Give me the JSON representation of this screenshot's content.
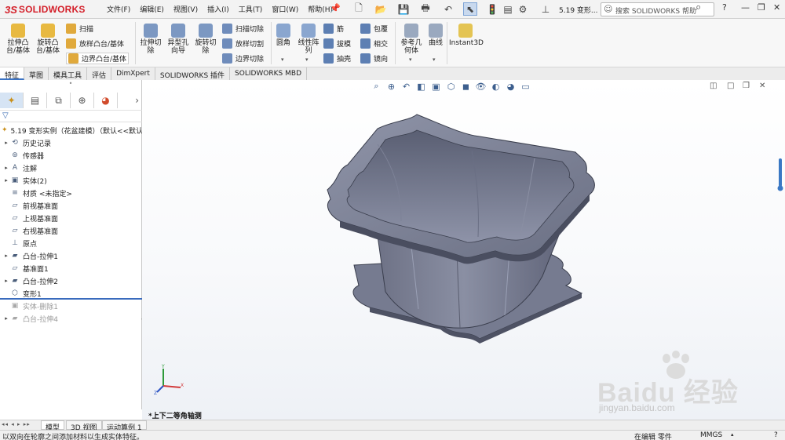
{
  "app": {
    "brand": "SOLIDWORKS",
    "doc_title": "5.19 变形...",
    "search_placeholder": "搜索 SOLIDWORKS 帮助"
  },
  "menus": [
    "文件(F)",
    "编辑(E)",
    "视图(V)",
    "插入(I)",
    "工具(T)",
    "窗口(W)",
    "帮助(H)"
  ],
  "commands": {
    "extrude_boss": "拉伸凸\n台/基体",
    "revolve_boss": "旋转凸\n台/基体",
    "sweep": "扫描",
    "loft_boss": "放样凸台/基体",
    "boundary_boss": "边界凸台/基体",
    "extrude_cut": "拉伸切\n除",
    "hole_wizard": "异型孔\n向导",
    "revolve_cut": "旋转切\n除",
    "swept_cut": "扫描切除",
    "lofted_cut": "放样切割",
    "boundary_cut": "边界切除",
    "fillet": "圆角",
    "linear_pattern": "线性阵\n列",
    "rib": "筋",
    "draft": "拔模",
    "shell": "抽壳",
    "wrap": "包覆",
    "intersect": "相交",
    "mirror": "镜向",
    "ref_geometry": "参考几\n何体",
    "curves": "曲线",
    "instant3d": "Instant3D"
  },
  "tabs": [
    "特征",
    "草图",
    "模具工具",
    "评估",
    "DimXpert",
    "SOLIDWORKS 插件",
    "SOLIDWORKS MBD"
  ],
  "tree": {
    "root": "5.19 变形实例（花盆建模）（默认<<默认",
    "items": [
      {
        "label": "历史记录",
        "expandable": true,
        "dim": false
      },
      {
        "label": "传感器",
        "expandable": false,
        "dim": false
      },
      {
        "label": "注解",
        "expandable": true,
        "dim": false
      },
      {
        "label": "实体(2)",
        "expandable": true,
        "dim": false
      },
      {
        "label": "材质 <未指定>",
        "expandable": false,
        "dim": false
      },
      {
        "label": "前视基准面",
        "expandable": false,
        "dim": false
      },
      {
        "label": "上视基准面",
        "expandable": false,
        "dim": false
      },
      {
        "label": "右视基准面",
        "expandable": false,
        "dim": false
      },
      {
        "label": "原点",
        "expandable": false,
        "dim": false
      },
      {
        "label": "凸台-拉伸1",
        "expandable": true,
        "dim": false
      },
      {
        "label": "基准面1",
        "expandable": false,
        "dim": false
      },
      {
        "label": "凸台-拉伸2",
        "expandable": true,
        "dim": false
      },
      {
        "label": "变形1",
        "expandable": false,
        "dim": false
      },
      {
        "label": "实体-删除1",
        "expandable": false,
        "dim": true
      },
      {
        "label": "凸台-拉伸4",
        "expandable": true,
        "dim": true
      }
    ]
  },
  "bottom_tabs": [
    "模型",
    "3D 视图",
    "运动算例 1"
  ],
  "viewport": {
    "view_name": "*上下二等角轴测",
    "triad_labels": {
      "x": "X",
      "y": "Y",
      "z": "Z"
    }
  },
  "status": {
    "hint": "以双向在轮廓之间添加材料以生成实体特征。",
    "edit_state": "在编辑 零件",
    "units": "MMGS"
  },
  "watermark": {
    "brand": "Baidu 经验",
    "url": "jingyan.baidu.com"
  }
}
